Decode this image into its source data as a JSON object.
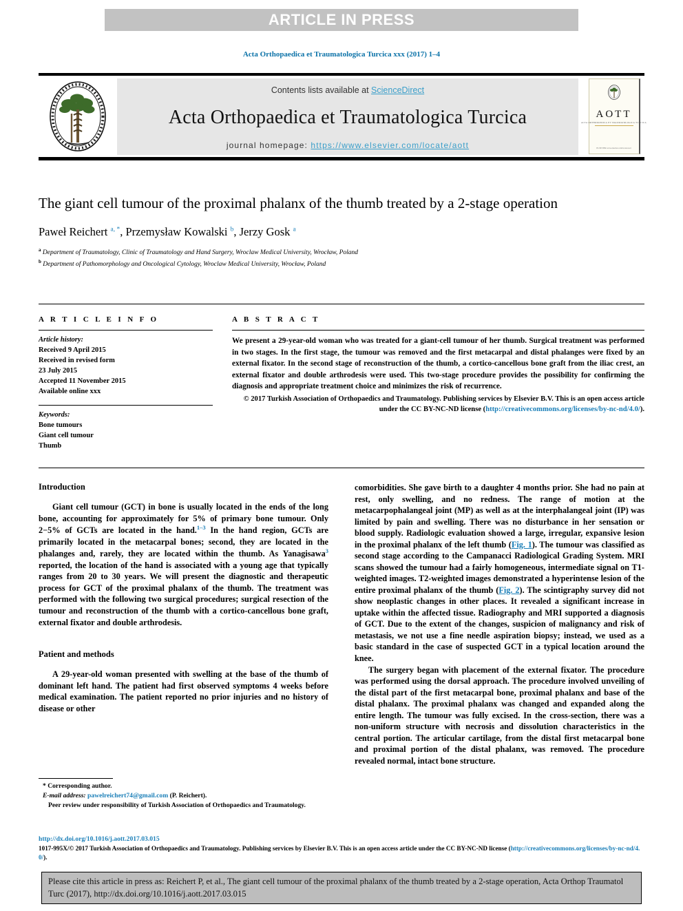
{
  "banner": {
    "text": "ARTICLE IN PRESS"
  },
  "journal_ref": "Acta Orthopaedica et Traumatologica Turcica xxx (2017) 1–4",
  "masthead": {
    "contents_prefix": "Contents lists available at ",
    "sciencedirect": "ScienceDirect",
    "journal_title": "Acta Orthopaedica et Traumatologica Turcica",
    "homepage_label": "journal homepage: ",
    "homepage_url": "https://www.elsevier.com/locate/aott",
    "society_logo_name": "acta-orthopaedica-et-traumatologica-turcica-seal",
    "cover_title": "AOTT",
    "cover_subtitle": "ACTA ORTHOPAEDICA ET TRAUMATOLOGICA TURCICA",
    "cover_footer": "ELSEVIER\nwww.elsevier.com/locate/aott"
  },
  "article": {
    "title": "The giant cell tumour of the proximal phalanx of the thumb treated by a 2-stage operation",
    "authors_html": "Paweł Reichert <sup>a</sup><sup>, *</sup>, Przemysław Kowalski <sup>b</sup>, Jerzy Gosk <sup>a</sup>",
    "affiliation_a": "Department of Traumatology, Clinic of Traumatology and Hand Surgery, Wroclaw Medical University, Wrocław, Poland",
    "affiliation_b": "Department of Pathomorphology and Oncological Cytology, Wroclaw Medical University, Wrocław, Poland"
  },
  "article_info": {
    "heading": "A R T I C L E   I N F O",
    "history_label": "Article history:",
    "history": [
      "Received 9 April 2015",
      "Received in revised form",
      "23 July 2015",
      "Accepted 11 November 2015",
      "Available online xxx"
    ],
    "keywords_label": "Keywords:",
    "keywords": [
      "Bone tumours",
      "Giant cell tumour",
      "Thumb"
    ]
  },
  "abstract": {
    "heading": "A B S T R A C T",
    "body": "We present a 29-year-old woman who was treated for a giant-cell tumour of her thumb. Surgical treatment was performed in two stages. In the first stage, the tumour was removed and the first metacarpal and distal phalanges were fixed by an external fixator. In the second stage of reconstruction of the thumb, a cortico-cancellous bone graft from the iliac crest, an external fixator and double arthrodesis were used. This two-stage procedure provides the possibility for confirming the diagnosis and appropriate treatment choice and minimizes the risk of recurrence.",
    "copyright_pre": "© 2017 Turkish Association of Orthopaedics and Traumatology. Publishing services by Elsevier B.V. This is an open access article under the CC BY-NC-ND license (",
    "copyright_link": "http://creativecommons.org/licenses/by-nc-nd/4.0/",
    "copyright_post": ")."
  },
  "sections": {
    "introduction_heading": "Introduction",
    "introduction_p1_a": "Giant cell tumour (GCT) in bone is usually located in the ends of the long bone, accounting for approximately for 5% of primary bone tumour. Only 2",
    "introduction_p1_b": "5% of GCTs are located in the hand.",
    "introduction_ref1": "1–3",
    "introduction_p1_c": " In the hand region, GCTs are primarily located in the metacarpal bones; second, they are located in the phalanges and, rarely, they are located within the thumb. As Yanagisawa",
    "introduction_ref2": "3",
    "introduction_p1_d": " reported, the location of the hand is associated with a young age that typically ranges from 20 to 30 years. We will present the diagnostic and therapeutic process for GCT of the proximal phalanx of the thumb. The treatment was performed with the following two surgical procedures; surgical resection of the tumour and reconstruction of the thumb with a cortico-cancellous bone graft, external fixator and double arthrodesis.",
    "patient_heading": "Patient and methods",
    "patient_p1": "A 29-year-old woman presented with swelling at the base of the thumb of dominant left hand. The patient had first observed symptoms 4 weeks before medical examination. The patient reported no prior injuries and no history of disease or other",
    "right_p1_a": "comorbidities. She gave birth to a daughter 4 months prior. She had no pain at rest, only swelling, and no redness. The range of motion at the metacarpophalangeal joint (MP) as well as at the interphalangeal joint (IP) was limited by pain and swelling. There was no disturbance in her sensation or blood supply. Radiologic evaluation showed a large, irregular, expansive lesion in the proximal phalanx of the left thumb (",
    "right_figref1": "Fig. 1",
    "right_p1_b": "). The tumour was classified as second stage according to the Campanacci Radiological Grading System. MRI scans showed the tumour had a fairly homogeneous, intermediate signal on T1-weighted images. T2-weighted images demonstrated a hyperintense lesion of the entire proximal phalanx of the thumb (",
    "right_figref2": "Fig. 2",
    "right_p1_c": "). The scintigraphy survey did not show neoplastic changes in other places. It revealed a significant increase in uptake within the affected tissue. Radiography and MRI supported a diagnosis of GCT. Due to the extent of the changes, suspicion of malignancy and risk of metastasis, we not use a fine needle aspiration biopsy; instead, we used as a basic standard in the case of suspected GCT in a typical location around the knee.",
    "right_p2": "The surgery began with placement of the external fixator. The procedure was performed using the dorsal approach. The procedure involved unveiling of the distal part of the first metacarpal bone, proximal phalanx and base of the distal phalanx. The proximal phalanx was changed and expanded along the entire length. The tumour was fully excised. In the cross-section, there was a non-uniform structure with necrosis and dissolution characteristics in the central portion. The articular cartilage, from the distal first metacarpal bone and proximal portion of the distal phalanx, was removed. The procedure revealed normal, intact bone structure."
  },
  "footnote": {
    "corresponding": "* Corresponding author.",
    "email_label": "E-mail address:",
    "email": "pawelreichert74@gmail.com",
    "email_suffix": " (P. Reichert).",
    "peer_review": "Peer review under responsibility of Turkish Association of Orthopaedics and Traumatology."
  },
  "bottom": {
    "doi": "http://dx.doi.org/10.1016/j.aott.2017.03.015",
    "issn_pre": "1017-995X/© 2017 Turkish Association of Orthopaedics and Traumatology. Publishing services by Elsevier B.V. This is an open access article under the CC BY-NC-ND license (",
    "issn_link": "http://creativecommons.org/licenses/by-nc-nd/4.0/",
    "issn_post": ").",
    "citation": "Please cite this article in press as: Reichert P, et al., The giant cell tumour of the proximal phalanx of the thumb treated by a 2-stage operation, Acta Orthop Traumatol Turc (2017), http://dx.doi.org/10.1016/j.aott.2017.03.015"
  },
  "colors": {
    "link": "#1b7fb8",
    "banner_bg": "#c2c2c2",
    "masthead_bg": "#e6e6e6",
    "cite_box_bg": "#bdbdbd"
  }
}
